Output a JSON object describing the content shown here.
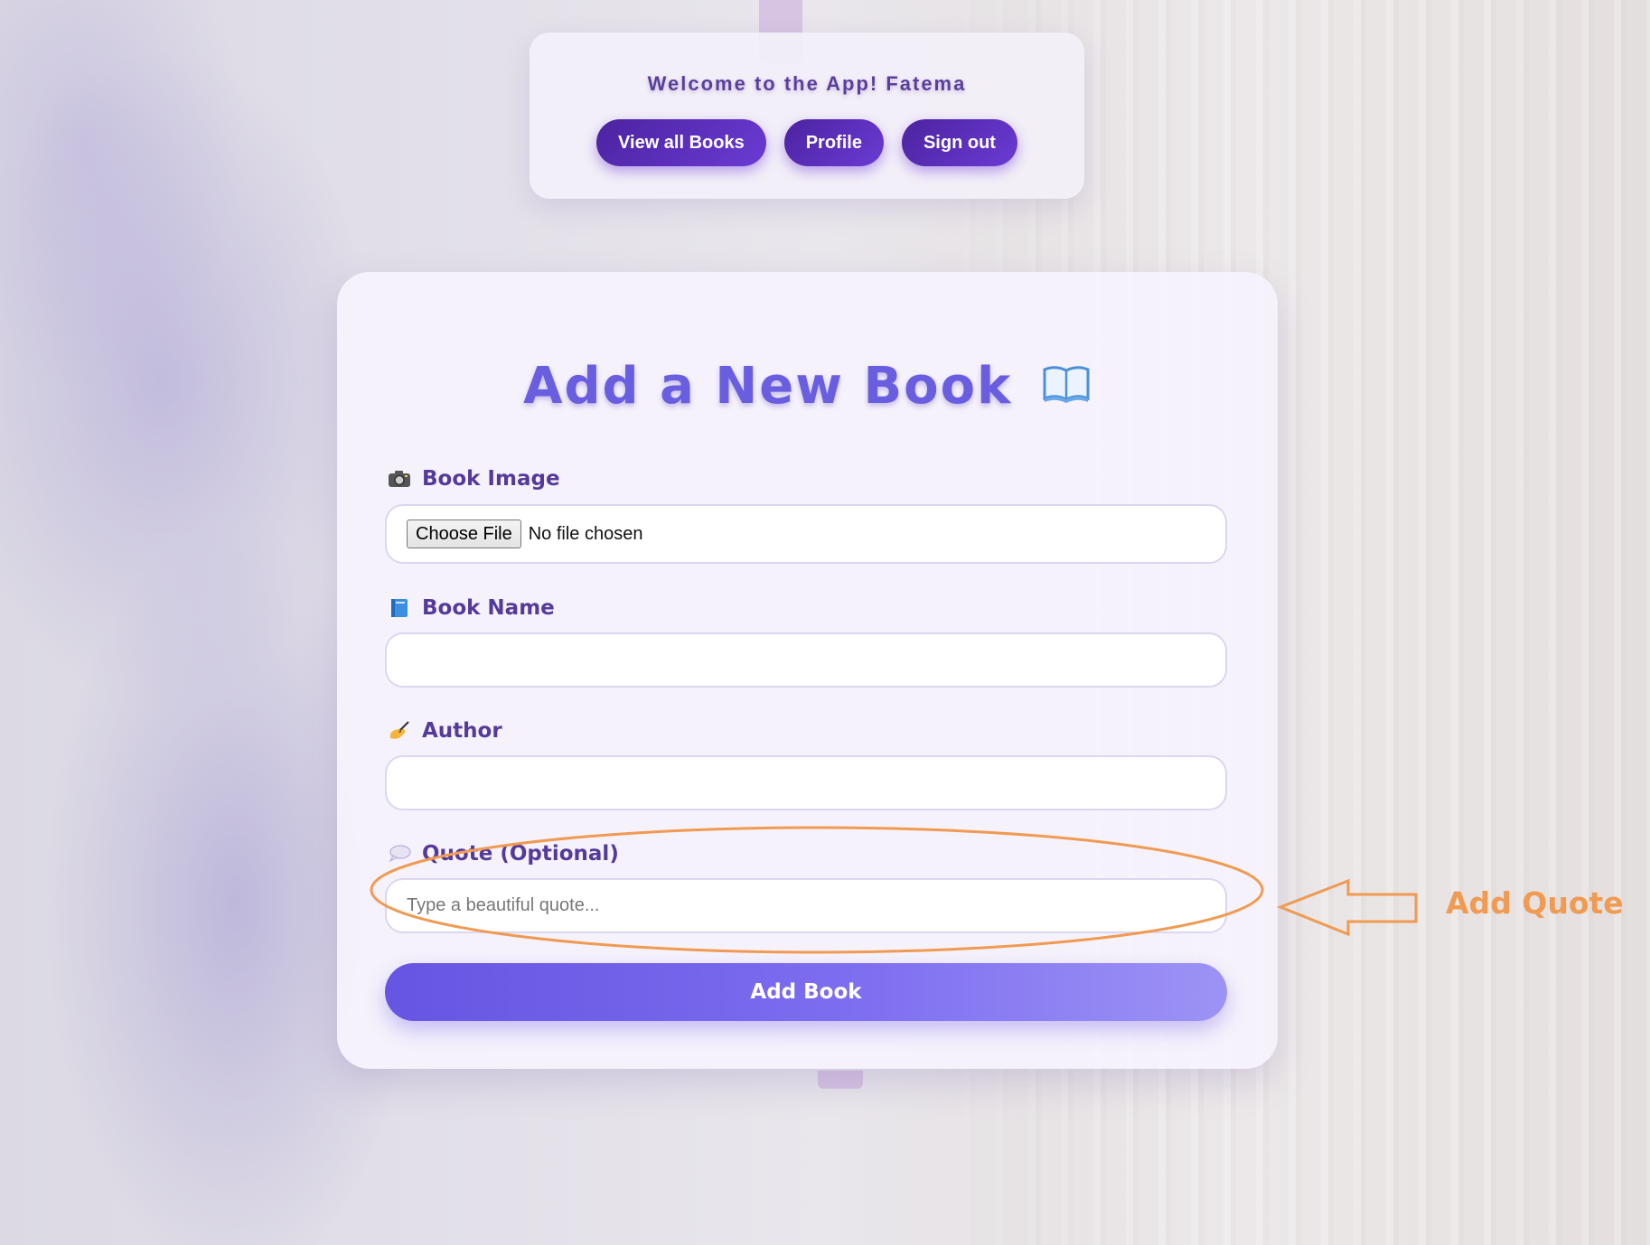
{
  "header": {
    "welcome_text": "Welcome to the App! Fatema",
    "nav": {
      "view_all_books": "View all Books",
      "profile": "Profile",
      "sign_out": "Sign out"
    }
  },
  "form": {
    "title": "Add a New Book",
    "title_icon": "open-book-icon",
    "fields": {
      "book_image": {
        "label": "Book Image",
        "icon": "camera-icon",
        "button": "Choose File",
        "status": "No file chosen"
      },
      "book_name": {
        "label": "Book Name",
        "icon": "blue-book-icon",
        "value": ""
      },
      "author": {
        "label": "Author",
        "icon": "writing-hand-icon",
        "value": ""
      },
      "quote": {
        "label": "Quote (Optional)",
        "icon": "speech-bubble-icon",
        "placeholder": "Type a beautiful quote...",
        "value": ""
      }
    },
    "submit_label": "Add Book"
  },
  "annotation": {
    "text": "Add Quote",
    "color": "#f09a52"
  },
  "colors": {
    "accent": "#6a5ee0",
    "nav_button": "#5a2fc0",
    "label": "#553a9a"
  }
}
